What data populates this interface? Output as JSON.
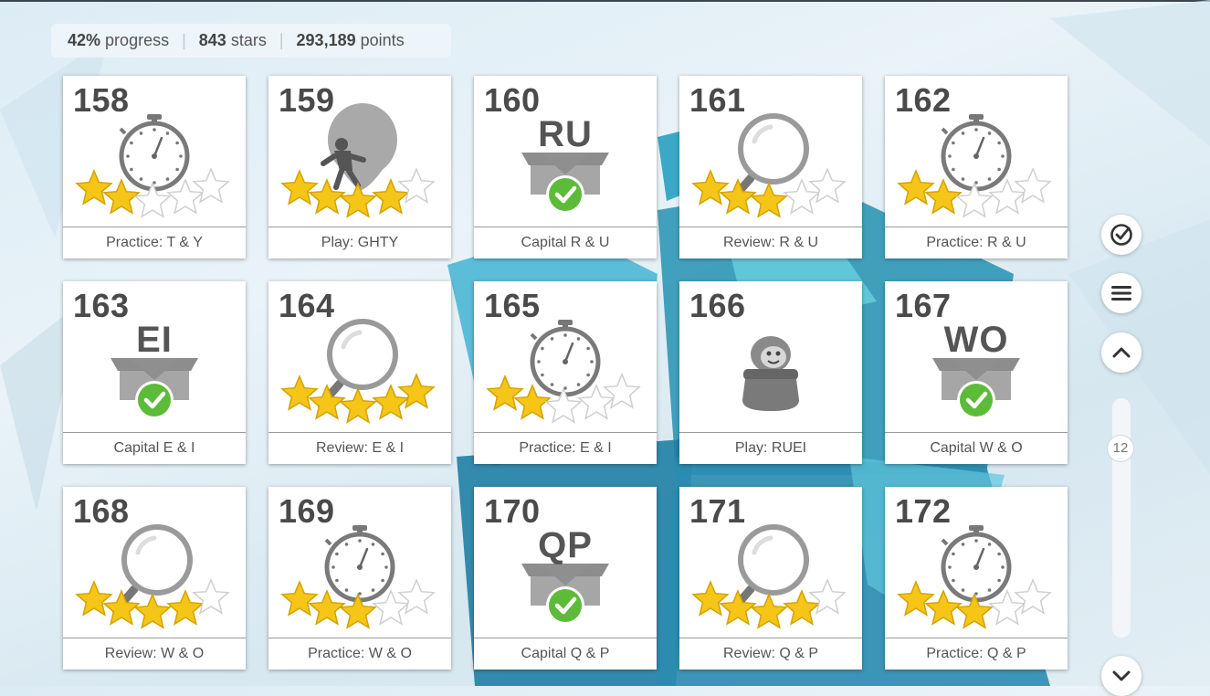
{
  "stats": {
    "progress_value": "42%",
    "progress_label": "progress",
    "stars_value": "843",
    "stars_label": "stars",
    "points_value": "293,189",
    "points_label": "points"
  },
  "lessons": [
    {
      "number": "158",
      "icon": "stopwatch-icon",
      "type": "practice",
      "stars": 2,
      "label": "Practice: T & Y"
    },
    {
      "number": "159",
      "icon": "balloon-runner-icon",
      "type": "play",
      "stars": 4,
      "label": "Play: GHTY"
    },
    {
      "number": "160",
      "icon": "box-check-icon",
      "type": "capital",
      "letters": "RU",
      "label": "Capital R & U"
    },
    {
      "number": "161",
      "icon": "magnifier-icon",
      "type": "review",
      "stars": 3,
      "label": "Review: R & U"
    },
    {
      "number": "162",
      "icon": "stopwatch-icon",
      "type": "practice",
      "stars": 2,
      "label": "Practice: R & U"
    },
    {
      "number": "163",
      "icon": "box-check-icon",
      "type": "capital",
      "letters": "EI",
      "label": "Capital E & I"
    },
    {
      "number": "164",
      "icon": "magnifier-icon",
      "type": "review",
      "stars": 5,
      "label": "Review: E & I"
    },
    {
      "number": "165",
      "icon": "stopwatch-icon",
      "type": "practice",
      "stars": 2,
      "label": "Practice: E & I"
    },
    {
      "number": "166",
      "icon": "creature-jar-icon",
      "type": "play",
      "stars": 0,
      "label": "Play: RUEI"
    },
    {
      "number": "167",
      "icon": "box-check-icon",
      "type": "capital",
      "letters": "WO",
      "label": "Capital W & O"
    },
    {
      "number": "168",
      "icon": "magnifier-icon",
      "type": "review",
      "stars": 4,
      "label": "Review: W & O"
    },
    {
      "number": "169",
      "icon": "stopwatch-icon",
      "type": "practice",
      "stars": 3,
      "label": "Practice: W & O"
    },
    {
      "number": "170",
      "icon": "box-check-icon",
      "type": "capital",
      "letters": "QP",
      "label": "Capital Q & P"
    },
    {
      "number": "171",
      "icon": "magnifier-icon",
      "type": "review",
      "stars": 4,
      "label": "Review: Q & P"
    },
    {
      "number": "172",
      "icon": "stopwatch-icon",
      "type": "practice",
      "stars": 3,
      "label": "Practice: Q & P"
    }
  ],
  "sidebar": {
    "buttons": [
      {
        "icon": "check-circle-icon"
      },
      {
        "icon": "menu-icon"
      },
      {
        "icon": "chevron-up-icon"
      },
      {
        "icon": "chevron-down-icon"
      }
    ],
    "scroll_position": "12"
  },
  "colors": {
    "star_gold": "#f5c518",
    "check_green": "#5dbb3a",
    "icon_gray": "#9a9a9a"
  }
}
